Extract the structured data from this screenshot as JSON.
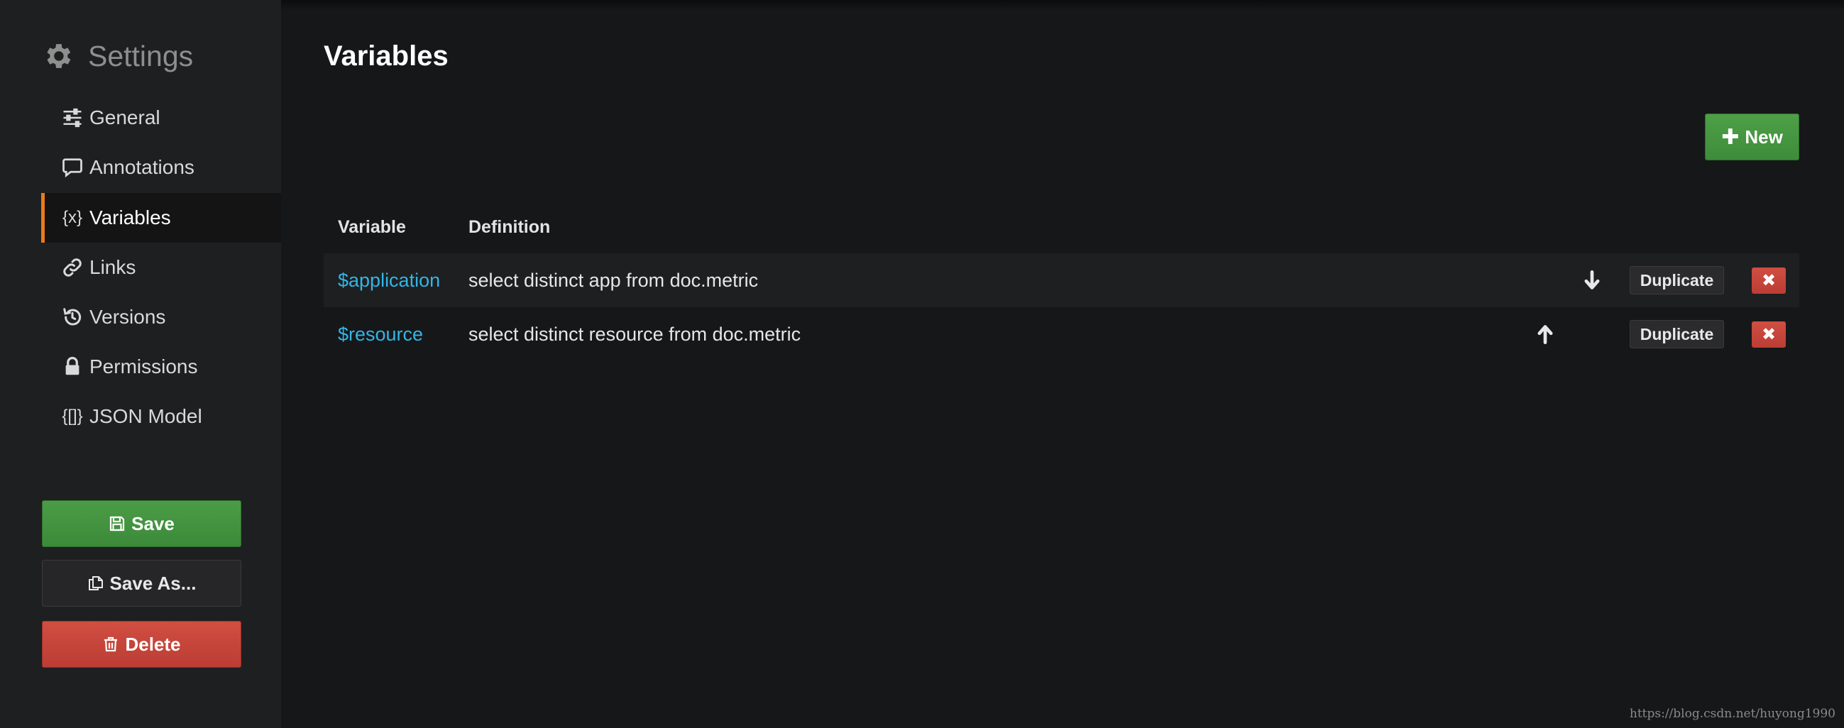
{
  "sidebar": {
    "title": "Settings",
    "items": [
      {
        "label": "General",
        "icon": "sliders-icon"
      },
      {
        "label": "Annotations",
        "icon": "comment-icon"
      },
      {
        "label": "Variables",
        "icon": "variable-icon",
        "icon_text": "{x}",
        "active": true
      },
      {
        "label": "Links",
        "icon": "link-icon"
      },
      {
        "label": "Versions",
        "icon": "history-icon"
      },
      {
        "label": "Permissions",
        "icon": "lock-icon"
      },
      {
        "label": "JSON Model",
        "icon": "json-icon",
        "icon_text": "{[]}"
      }
    ],
    "save_label": "Save",
    "save_as_label": "Save As...",
    "delete_label": "Delete"
  },
  "main": {
    "title": "Variables",
    "new_label": "New",
    "table": {
      "headers": [
        "Variable",
        "Definition"
      ],
      "rows": [
        {
          "variable": "$application",
          "definition": "select distinct app from doc.metric",
          "move": "down"
        },
        {
          "variable": "$resource",
          "definition": "select distinct resource from doc.metric",
          "move": "up"
        }
      ],
      "duplicate_label": "Duplicate",
      "remove_label": "✖"
    }
  },
  "watermark": "https://blog.csdn.net/huyong1990",
  "colors": {
    "accent": "#eb7b18",
    "link": "#33b5e5",
    "success": "#3d8c3b",
    "danger": "#c0423a"
  }
}
